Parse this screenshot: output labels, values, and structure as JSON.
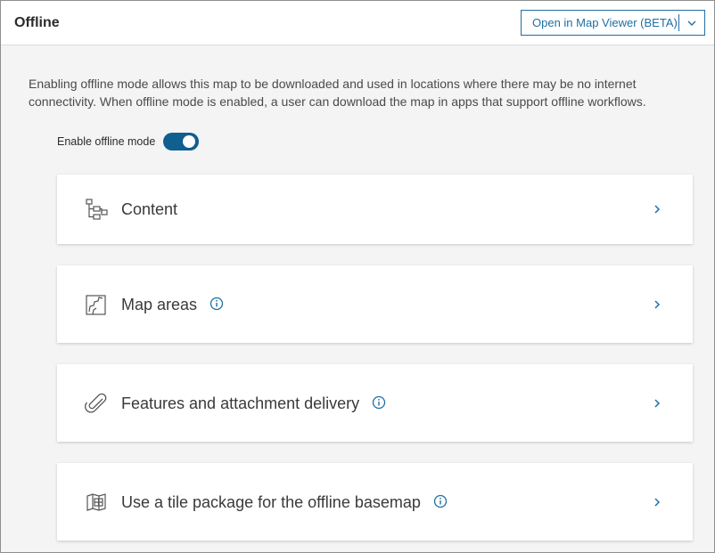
{
  "header": {
    "title": "Offline",
    "open_button_label": "Open in Map Viewer (BETA)",
    "dropdown_icon": "chevron-down-icon"
  },
  "description": "Enabling offline mode allows this map to be downloaded and used in locations where there may be no internet connectivity. When offline mode is enabled, a user can download the map in apps that support offline workflows.",
  "offline_toggle": {
    "label": "Enable offline mode",
    "enabled": true
  },
  "sections": [
    {
      "label": "Content",
      "icon": "content-hierarchy-icon",
      "has_info": false
    },
    {
      "label": "Map areas",
      "icon": "map-area-icon",
      "has_info": true
    },
    {
      "label": "Features and attachment delivery",
      "icon": "paperclip-icon",
      "has_info": true
    },
    {
      "label": "Use a tile package for the offline basemap",
      "icon": "tile-package-map-icon",
      "has_info": true
    }
  ],
  "colors": {
    "accent": "#1f6fa3",
    "toggle_on": "#0f5f8f",
    "background": "#f4f4f4",
    "text": "#3a3a3a"
  }
}
